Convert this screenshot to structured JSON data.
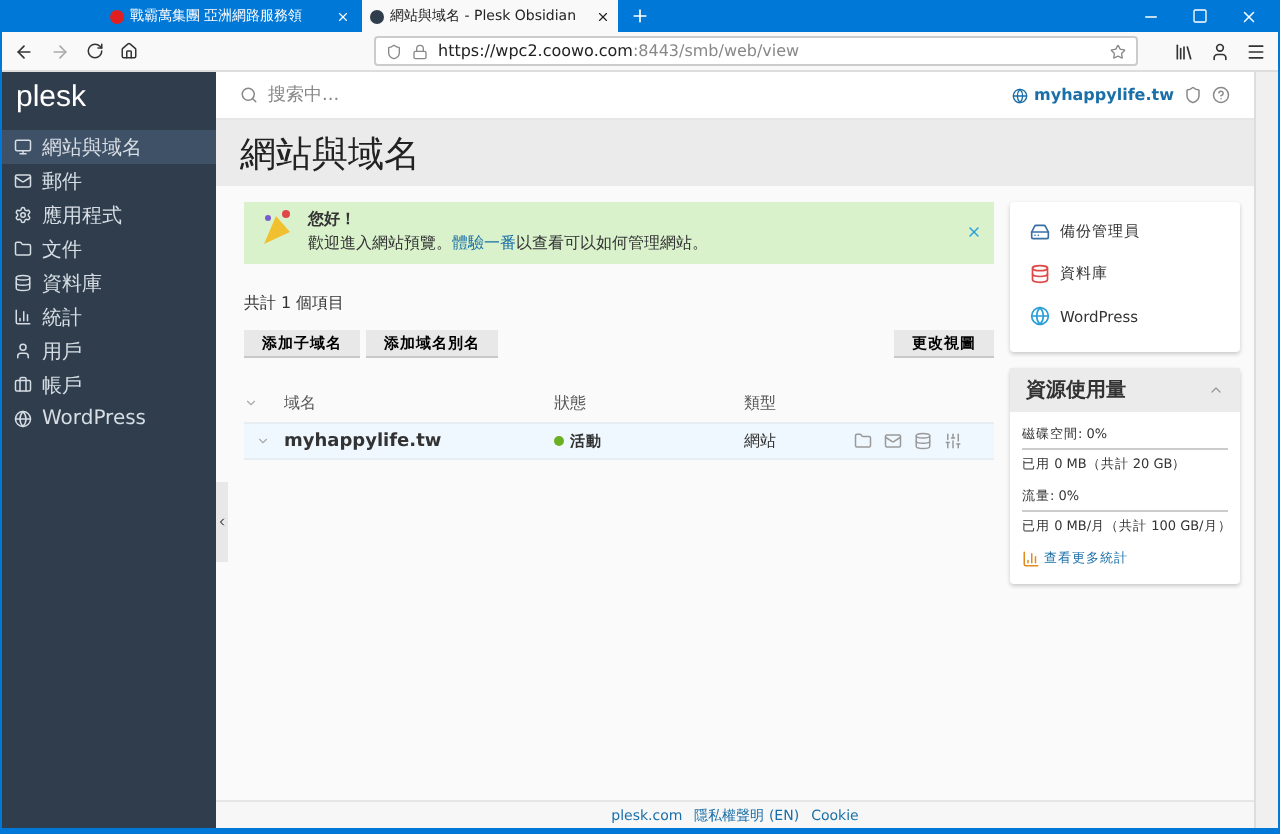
{
  "browser": {
    "tabs": [
      {
        "title": "戰霸萬集團 亞洲網路服務領",
        "selected": false
      },
      {
        "title": "網站與域名 - Plesk Obsidian",
        "selected": true
      }
    ],
    "url_host": "https://wpc2.coowo.com",
    "url_path": ":8443/smb/web/view"
  },
  "sidebar": {
    "brand": "plesk",
    "items": [
      {
        "label": "網站與域名",
        "selected": true
      },
      {
        "label": "郵件",
        "selected": false
      },
      {
        "label": "應用程式",
        "selected": false
      },
      {
        "label": "文件",
        "selected": false
      },
      {
        "label": "資料庫",
        "selected": false
      },
      {
        "label": "統計",
        "selected": false
      },
      {
        "label": "用戶",
        "selected": false
      },
      {
        "label": "帳戶",
        "selected": false
      },
      {
        "label": "WordPress",
        "selected": false
      }
    ]
  },
  "header": {
    "search_placeholder": "搜索中...",
    "domain": "myhappylife.tw"
  },
  "page_title": "網站與域名",
  "alert": {
    "title": "您好！",
    "before": "歡迎進入網站預覽。",
    "link": "體驗一番",
    "after": "以查看可以如何管理網站。"
  },
  "count": "共計 1 個項目",
  "buttons": [
    "添加子域名",
    "添加域名別名"
  ],
  "view_button": "更改視圖",
  "columns": [
    "域名",
    "狀態",
    "類型"
  ],
  "rows": [
    {
      "domain": "myhappylife.tw",
      "status": "活動",
      "type": "網站",
      "active": true
    }
  ],
  "tools": [
    "備份管理員",
    "資料庫",
    "WordPress"
  ],
  "resources": {
    "title": "資源使用量",
    "lines": [
      {
        "label": "磁碟空間: 0%",
        "detail": "已用 0 MB（共計 20 GB）"
      },
      {
        "label": "流量: 0%",
        "detail": "已用 0 MB/月（共計 100 GB/月）"
      }
    ],
    "link": "查看更多統計"
  },
  "footer": [
    "plesk.com",
    "隱私權聲明 (EN)",
    "Cookie"
  ]
}
